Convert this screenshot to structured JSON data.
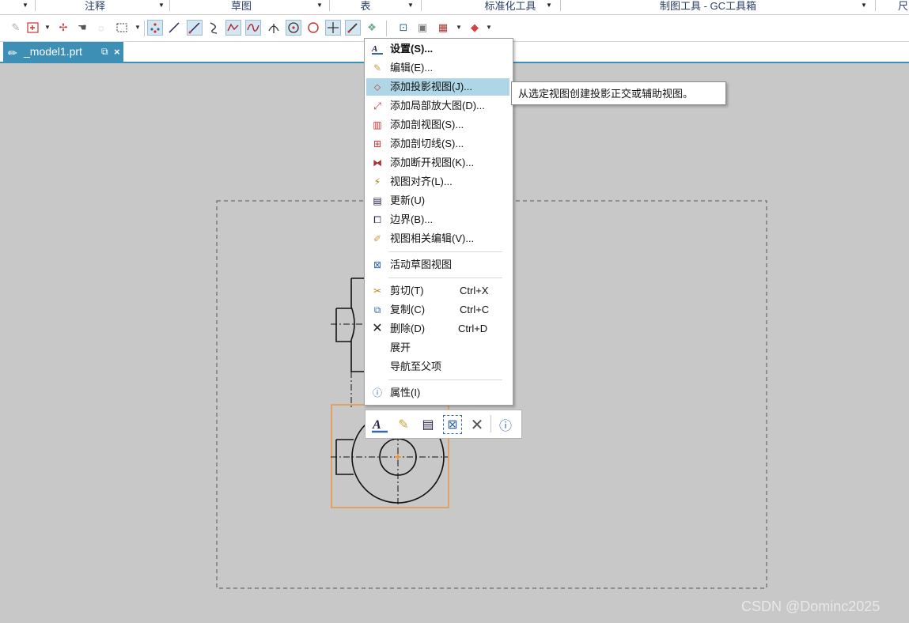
{
  "ribbon": {
    "groups": [
      "注释",
      "草图",
      "表",
      "标准化工具",
      "制图工具 - GC工具箱",
      "尺"
    ]
  },
  "toolbar": {
    "icons": [
      "snap-icon",
      "insert-view-icon",
      "drag-icon",
      "hand-icon",
      "lasso-icon",
      "select-box-icon",
      "point-icon",
      "line-icon",
      "line-tool-icon",
      "arc-icon",
      "spline-icon",
      "curve-icon",
      "intersect-icon",
      "circle-center-icon",
      "circle-icon",
      "cross-icon",
      "pencil-icon",
      "sketch-icon",
      "zoom-icon",
      "view-icon",
      "table-icon",
      "render-icon"
    ]
  },
  "tab": {
    "label": "_model1.prt",
    "close": "×"
  },
  "context_menu": {
    "items": [
      {
        "label": "设置(S)...",
        "icon": "settings-icon",
        "bold": true
      },
      {
        "label": "编辑(E)...",
        "icon": "edit-icon"
      },
      {
        "label": "添加投影视图(J)...",
        "icon": "projected-view-icon",
        "highlighted": true
      },
      {
        "label": "添加局部放大图(D)...",
        "icon": "detail-view-icon"
      },
      {
        "label": "添加剖视图(S)...",
        "icon": "section-view-icon"
      },
      {
        "label": "添加剖切线(S)...",
        "icon": "section-line-icon"
      },
      {
        "label": "添加断开视图(K)...",
        "icon": "break-view-icon"
      },
      {
        "label": "视图对齐(L)...",
        "icon": "align-view-icon"
      },
      {
        "label": "更新(U)",
        "icon": "update-icon"
      },
      {
        "label": "边界(B)...",
        "icon": "boundary-icon"
      },
      {
        "label": "视图相关编辑(V)...",
        "icon": "view-dependent-edit-icon"
      },
      {
        "label": "活动草图视图",
        "icon": "active-sketch-view-icon"
      },
      {
        "label": "剪切(T)",
        "icon": "scissors-icon",
        "shortcut": "Ctrl+X"
      },
      {
        "label": "复制(C)",
        "icon": "copy-icon",
        "shortcut": "Ctrl+C"
      },
      {
        "label": "删除(D)",
        "icon": "delete-icon",
        "shortcut": "Ctrl+D"
      },
      {
        "label": "展开",
        "icon": ""
      },
      {
        "label": "导航至父项",
        "icon": ""
      },
      {
        "label": "属性(I)",
        "icon": "properties-icon"
      }
    ]
  },
  "tooltip": {
    "text": "从选定视图创建投影正交或辅助视图。"
  },
  "mini_toolbar": {
    "icons": [
      "settings-icon",
      "edit-icon",
      "update-icon",
      "active-sketch-view-icon",
      "delete-icon",
      "properties-icon"
    ]
  },
  "colors": {
    "canvas": "#c8c8c8",
    "accent": "#3e8fb5",
    "highlight": "#aed6e6",
    "selection": "#f08a24",
    "ribbon_text": "#2b3f66"
  },
  "watermark": "CSDN @Dominc2025"
}
